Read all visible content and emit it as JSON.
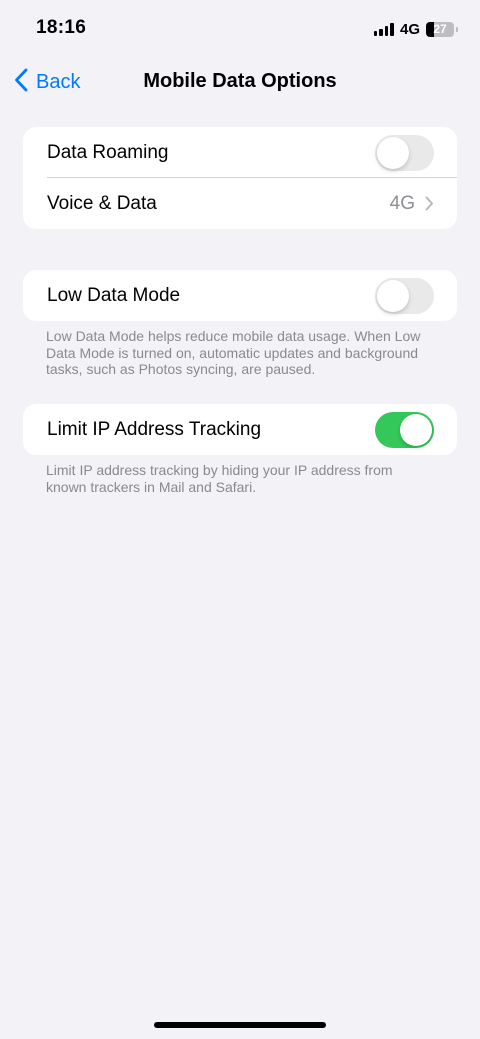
{
  "status_bar": {
    "time": "18:16",
    "network": "4G",
    "battery": "27",
    "battery_level_percent": 27
  },
  "nav": {
    "back_label": "Back",
    "title": "Mobile Data Options"
  },
  "group1": {
    "data_roaming": {
      "label": "Data Roaming",
      "enabled": false
    },
    "voice_data": {
      "label": "Voice & Data",
      "value": "4G"
    }
  },
  "group2": {
    "low_data_mode": {
      "label": "Low Data Mode",
      "enabled": false
    },
    "footnote": "Low Data Mode helps reduce mobile data usage. When Low Data Mode is turned on, automatic updates and background tasks, such as Photos syncing, are paused."
  },
  "group3": {
    "limit_ip": {
      "label": "Limit IP Address Tracking",
      "enabled": true
    },
    "footnote": "Limit IP address tracking by hiding your IP address from known trackers in Mail and Safari."
  },
  "colors": {
    "accent": "#007aff",
    "toggle_on": "#34c759",
    "background": "#f2f2f7"
  },
  "icons": {
    "back": "chevron-left-icon",
    "disclosure": "chevron-right-icon"
  }
}
